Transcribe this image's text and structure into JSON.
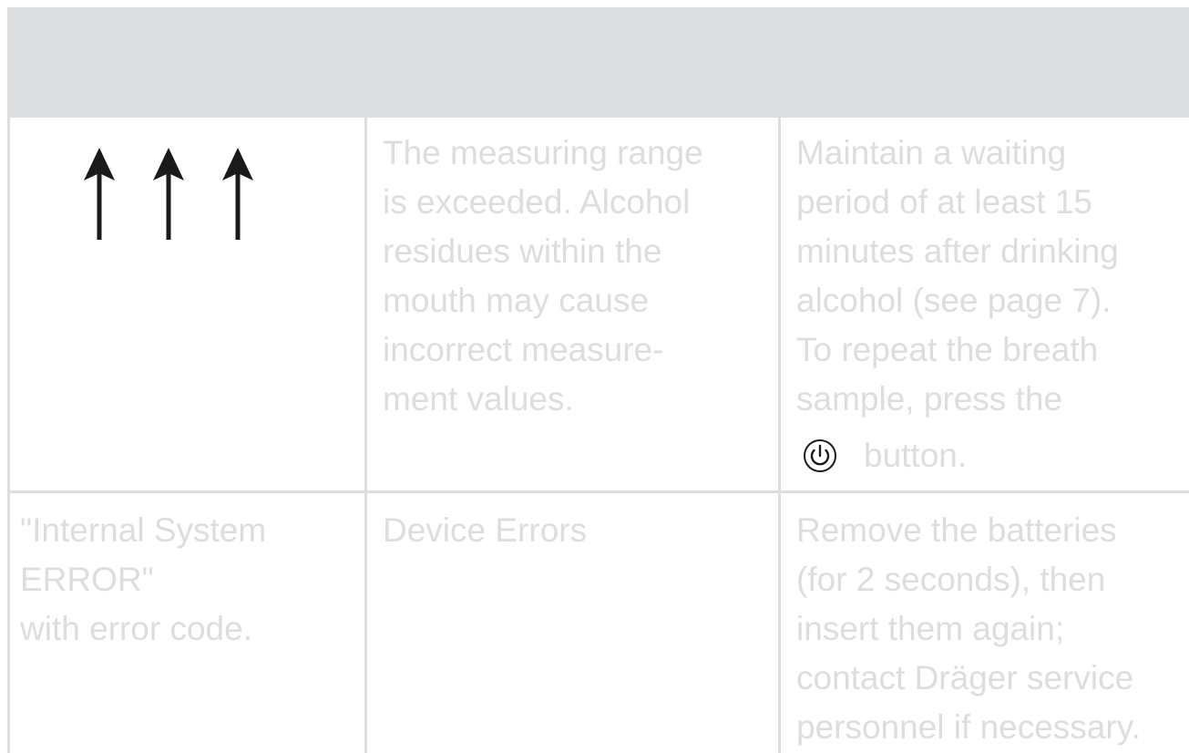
{
  "table": {
    "header": {
      "cells": [
        "",
        "",
        ""
      ]
    },
    "rows": [
      {
        "display_icon": "three-up-arrows-icon",
        "cause": "The measuring range\nis exceeded. Alcohol\nresidues within the\nmouth may cause\nincorrect measure-\nment values.",
        "remedy": "Maintain a waiting\nperiod of at least 15\nminutes after drinking\nalcohol (see page 7).\nTo repeat the breath\nsample, press the",
        "remedy_icon": "power-button-icon",
        "remedy_suffix": "button."
      },
      {
        "display": "\"Internal System\nERROR\"\nwith error code.",
        "cause": "Device Errors",
        "remedy": "Remove the batteries\n(for 2 seconds), then\ninsert them again;\ncontact Dräger service\npersonnel if necessary."
      }
    ]
  },
  "colors": {
    "header_band": "#dcdddf",
    "grid_lines": "#dcdddf",
    "text": "#dcdddf",
    "icon": "#1a1a1a"
  }
}
